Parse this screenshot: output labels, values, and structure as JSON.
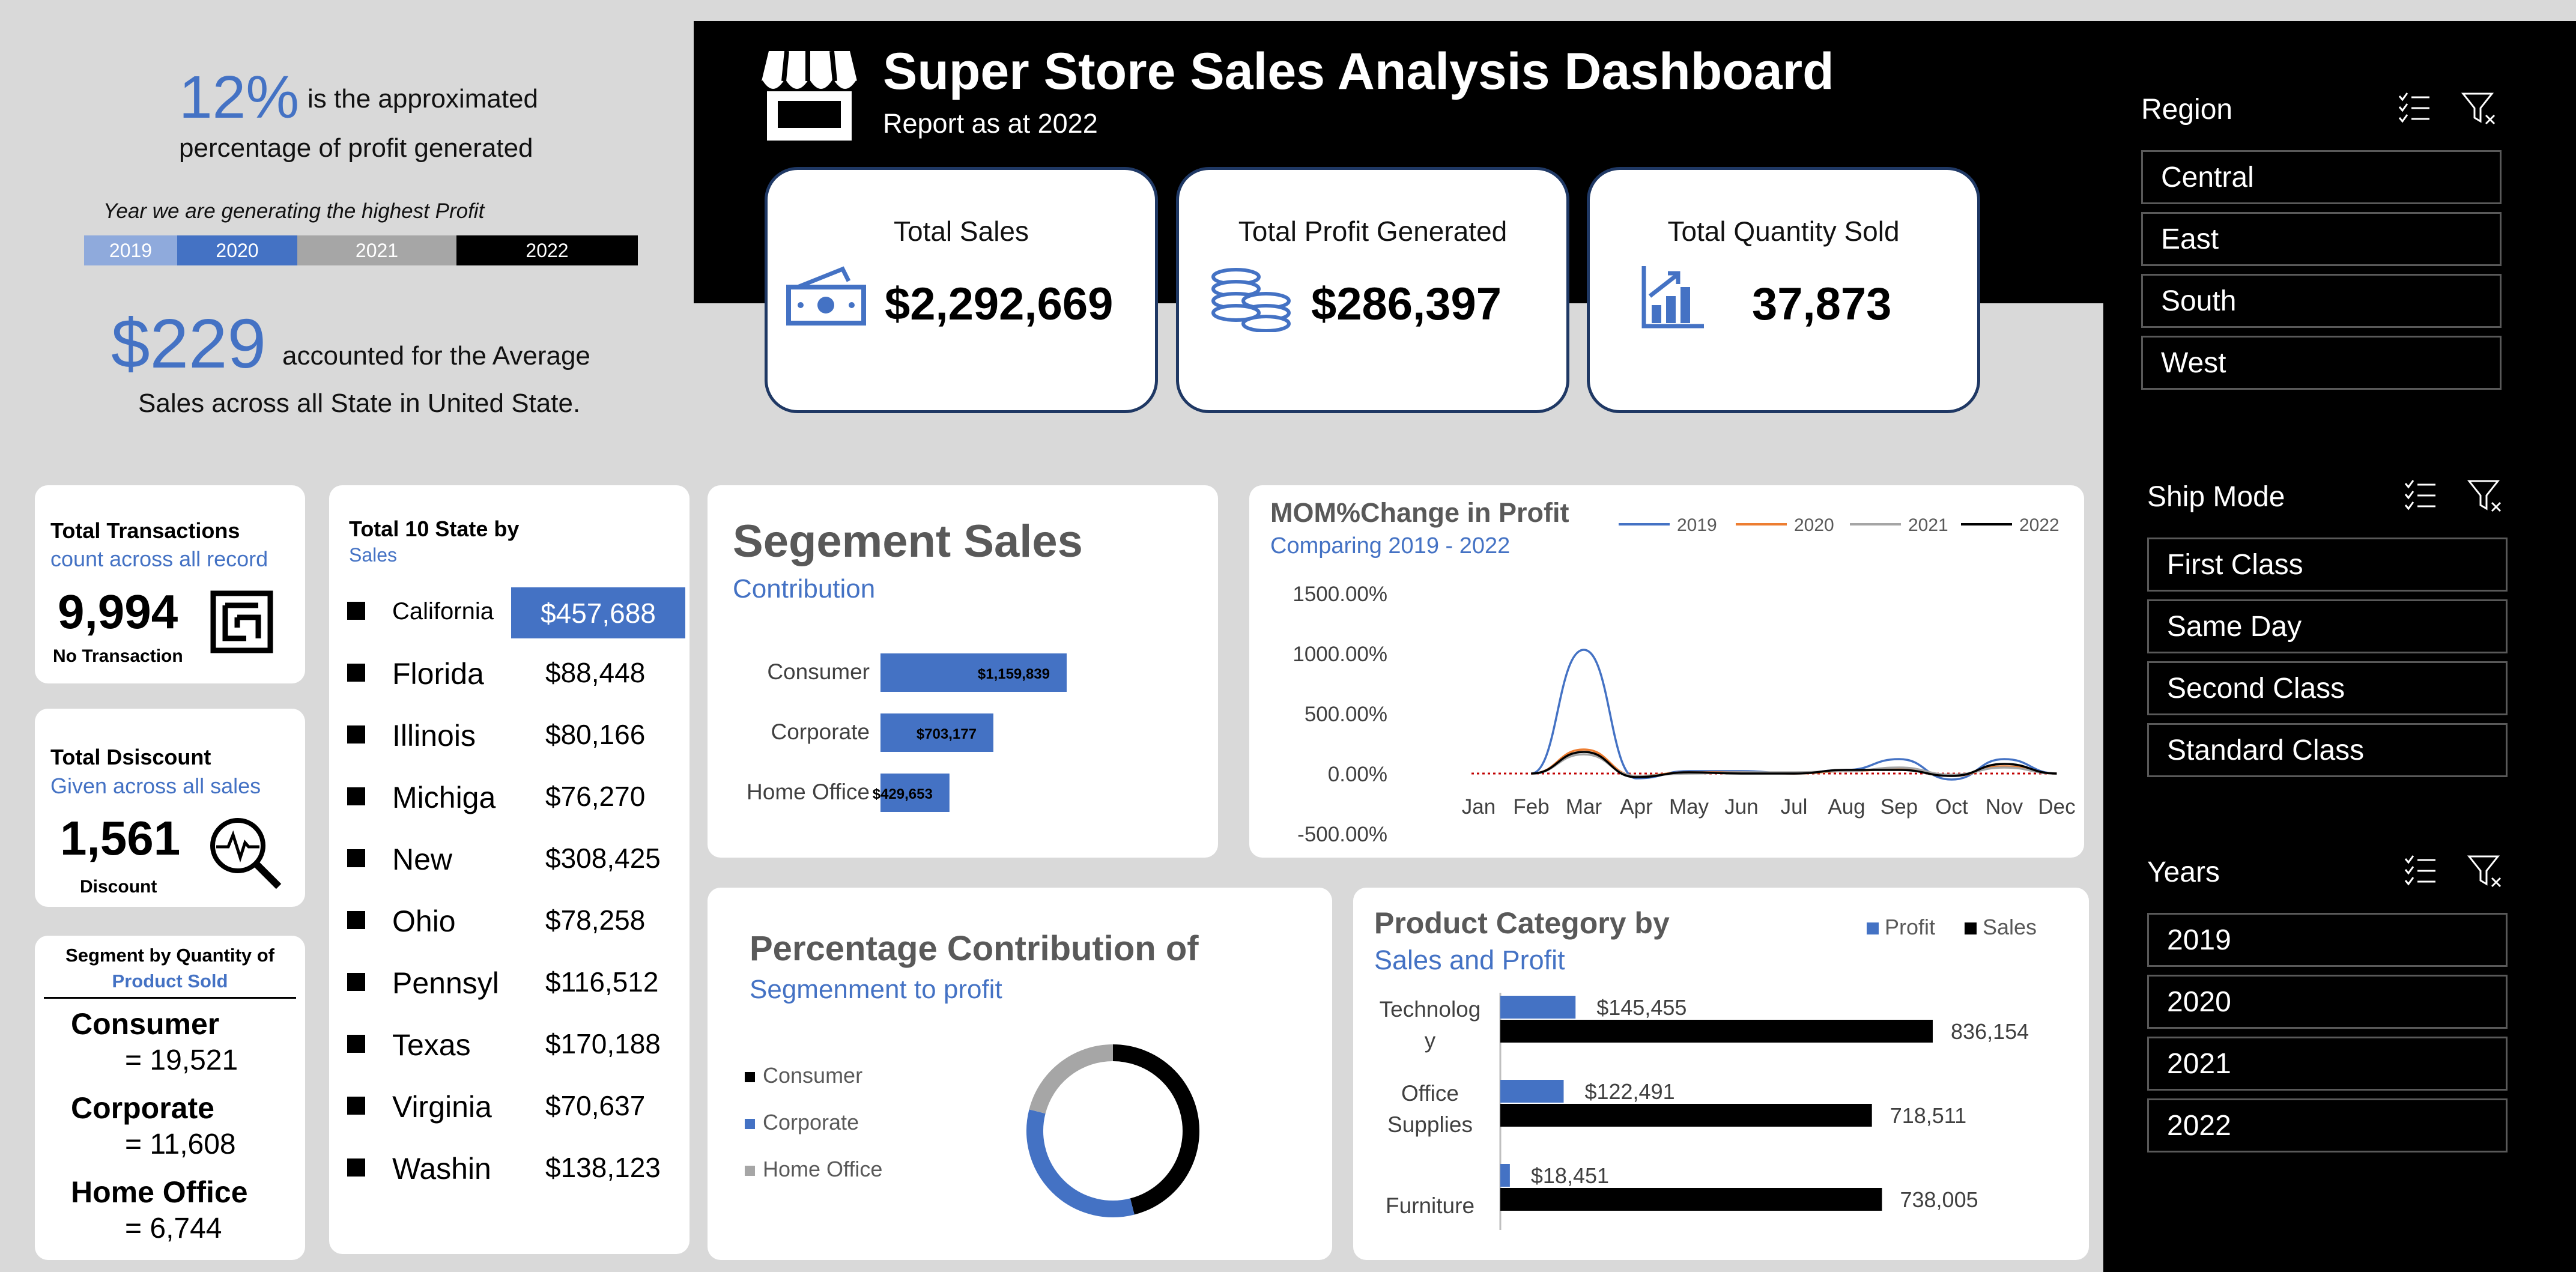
{
  "summary": {
    "pct": "12%",
    "pct_text_1": "is the approximated",
    "pct_text_2": "percentage of profit generated",
    "year_caption": "Year we are generating the highest Profit",
    "years": [
      {
        "label": "2019",
        "color": "#8faadc"
      },
      {
        "label": "2020",
        "color": "#4472c4"
      },
      {
        "label": "2021",
        "color": "#a6a6a6"
      },
      {
        "label": "2022",
        "color": "#000000"
      }
    ],
    "avg_value": "$229",
    "avg_text_1": "accounted for the Average",
    "avg_text_2": "Sales across all State in United State."
  },
  "header": {
    "title": "Super Store Sales Analysis Dashboard",
    "subtitle": "Report as at 2022"
  },
  "kpis": [
    {
      "title": "Total Sales",
      "value": "$2,292,669",
      "icon": "money-icon"
    },
    {
      "title": "Total Profit Generated",
      "value": "$286,397",
      "icon": "coins-icon"
    },
    {
      "title": "Total Quantity Sold",
      "value": "37,873",
      "icon": "growth-chart-icon"
    }
  ],
  "transactions": {
    "title": "Total Transactions",
    "subtitle": "count across all record",
    "value": "9,994",
    "caption": "No Transaction"
  },
  "discount": {
    "title": "Total Dsiscount",
    "subtitle": "Given across all sales",
    "value": "1,561",
    "caption": "Discount"
  },
  "segment_qty": {
    "title": "Segment by Quantity of",
    "subtitle": "Product Sold",
    "items": [
      {
        "name": "Consumer",
        "value": "= 19,521"
      },
      {
        "name": "Corporate",
        "value": "= 11,608"
      },
      {
        "name": "Home Office",
        "value": "= 6,744"
      }
    ]
  },
  "states": {
    "title": "Total 10 State by",
    "subtitle": "Sales",
    "rows": [
      {
        "name": "California",
        "value": "$457,688"
      },
      {
        "name": "Florida",
        "value": "$88,448"
      },
      {
        "name": "Illinois",
        "value": "$80,166"
      },
      {
        "name": "Michiga",
        "value": "$76,270"
      },
      {
        "name": "New",
        "value": "$308,425"
      },
      {
        "name": "Ohio",
        "value": "$78,258"
      },
      {
        "name": "Pennsyl",
        "value": "$116,512"
      },
      {
        "name": "Texas",
        "value": "$170,188"
      },
      {
        "name": "Virginia",
        "value": "$70,637"
      },
      {
        "name": "Washin",
        "value": "$138,123"
      }
    ]
  },
  "segment_sales": {
    "title": "Segement Sales",
    "subtitle": "Contribution"
  },
  "mom": {
    "title": "MOM%Change in Profit",
    "subtitle": "Comparing 2019 - 2022"
  },
  "pct_contrib": {
    "title": "Percentage Contribution of",
    "subtitle": "Segmenment to profit"
  },
  "category": {
    "title": "Product Category by",
    "subtitle": "Sales and Profit"
  },
  "slicers": [
    {
      "title": "Region",
      "items": [
        "Central",
        "East",
        "South",
        "West"
      ]
    },
    {
      "title": "Ship Mode",
      "items": [
        "First Class",
        "Same Day",
        "Second Class",
        "Standard Class"
      ]
    },
    {
      "title": "Years",
      "items": [
        "2019",
        "2020",
        "2021",
        "2022"
      ]
    }
  ],
  "chart_data": [
    {
      "type": "bar",
      "title": "Segement Sales",
      "subtitle": "Contribution",
      "categories": [
        "Consumer",
        "Corporate",
        "Home Office"
      ],
      "values": [
        1159839,
        703177,
        429653
      ],
      "labels": [
        "$1,159,839",
        "$703,177",
        "$429,653"
      ],
      "orientation": "horizontal",
      "color": "#4472c4"
    },
    {
      "type": "line",
      "title": "MOM%Change in Profit",
      "subtitle": "Comparing 2019 - 2022",
      "categories": [
        "Jan",
        "Feb",
        "Mar",
        "Apr",
        "May",
        "Jun",
        "Jul",
        "Aug",
        "Sep",
        "Oct",
        "Nov",
        "Dec"
      ],
      "series": [
        {
          "name": "2019",
          "color": "#4472c4",
          "values": [
            null,
            0,
            1030,
            -40,
            20,
            20,
            0,
            30,
            120,
            -50,
            120,
            0
          ]
        },
        {
          "name": "2020",
          "color": "#ed7d31",
          "values": [
            null,
            0,
            200,
            -20,
            10,
            10,
            0,
            20,
            40,
            -20,
            60,
            0
          ]
        },
        {
          "name": "2021",
          "color": "#a5a5a5",
          "values": [
            null,
            0,
            160,
            -20,
            0,
            10,
            10,
            20,
            50,
            -10,
            50,
            0
          ]
        },
        {
          "name": "2022",
          "color": "#000000",
          "values": [
            null,
            0,
            180,
            -30,
            10,
            0,
            0,
            30,
            30,
            -20,
            80,
            0
          ]
        }
      ],
      "yticks": [
        "1500.00%",
        "1000.00%",
        "500.00%",
        "0.00%",
        "-500.00%"
      ],
      "ylim": [
        -500,
        1500
      ],
      "legend": "top-right"
    },
    {
      "type": "pie",
      "title": "Percentage Contribution of",
      "subtitle": "Segmenment to profit",
      "categories": [
        "Consumer",
        "Corporate",
        "Home Office"
      ],
      "values": [
        46,
        33,
        21
      ],
      "colors": [
        "#000000",
        "#4472c4",
        "#a6a6a6"
      ],
      "legend": "left"
    },
    {
      "type": "bar",
      "title": "Product Category by",
      "subtitle": "Sales and Profit",
      "categories": [
        "Technology",
        "Office Supplies",
        "Furniture"
      ],
      "category_lines": [
        [
          "Technolog",
          "y"
        ],
        [
          "Office",
          "Supplies"
        ],
        [
          "Furniture"
        ]
      ],
      "series": [
        {
          "name": "Profit",
          "color": "#4472c4",
          "values": [
            145455,
            122491,
            18451
          ],
          "labels": [
            "$145,455",
            "$122,491",
            "$18,451"
          ]
        },
        {
          "name": "Sales",
          "color": "#000000",
          "values": [
            836154,
            718511,
            738005
          ],
          "labels": [
            "836,154",
            "718,511",
            "738,005"
          ]
        }
      ],
      "orientation": "horizontal",
      "legend": "top-right"
    }
  ]
}
